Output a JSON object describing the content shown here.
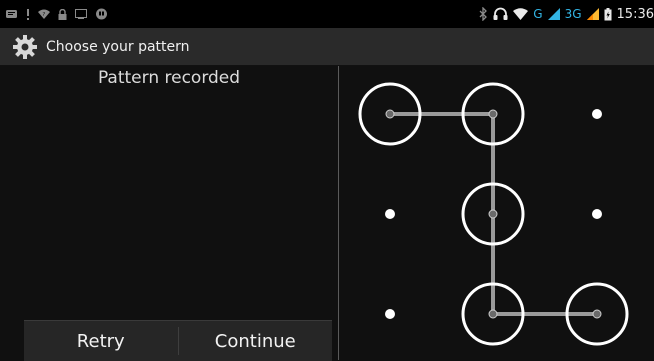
{
  "statusbar": {
    "network_label": "G",
    "network_label_2": "3G",
    "time": "15:36"
  },
  "actionbar": {
    "title": "Choose your pattern"
  },
  "left": {
    "header": "Pattern recorded",
    "retry_label": "Retry",
    "continue_label": "Continue"
  },
  "pattern": {
    "grid": [
      {
        "row": 0,
        "col": 0,
        "selected": true
      },
      {
        "row": 0,
        "col": 1,
        "selected": true
      },
      {
        "row": 0,
        "col": 2,
        "selected": false
      },
      {
        "row": 1,
        "col": 0,
        "selected": false
      },
      {
        "row": 1,
        "col": 1,
        "selected": true
      },
      {
        "row": 1,
        "col": 2,
        "selected": false
      },
      {
        "row": 2,
        "col": 0,
        "selected": false
      },
      {
        "row": 2,
        "col": 1,
        "selected": true
      },
      {
        "row": 2,
        "col": 2,
        "selected": true
      }
    ],
    "path": [
      [
        0,
        0
      ],
      [
        0,
        1
      ],
      [
        1,
        1
      ],
      [
        2,
        1
      ],
      [
        2,
        2
      ]
    ]
  },
  "colors": {
    "accent": "#33b5e5",
    "ring": "#ffffff",
    "path": "#9a9a9a"
  }
}
